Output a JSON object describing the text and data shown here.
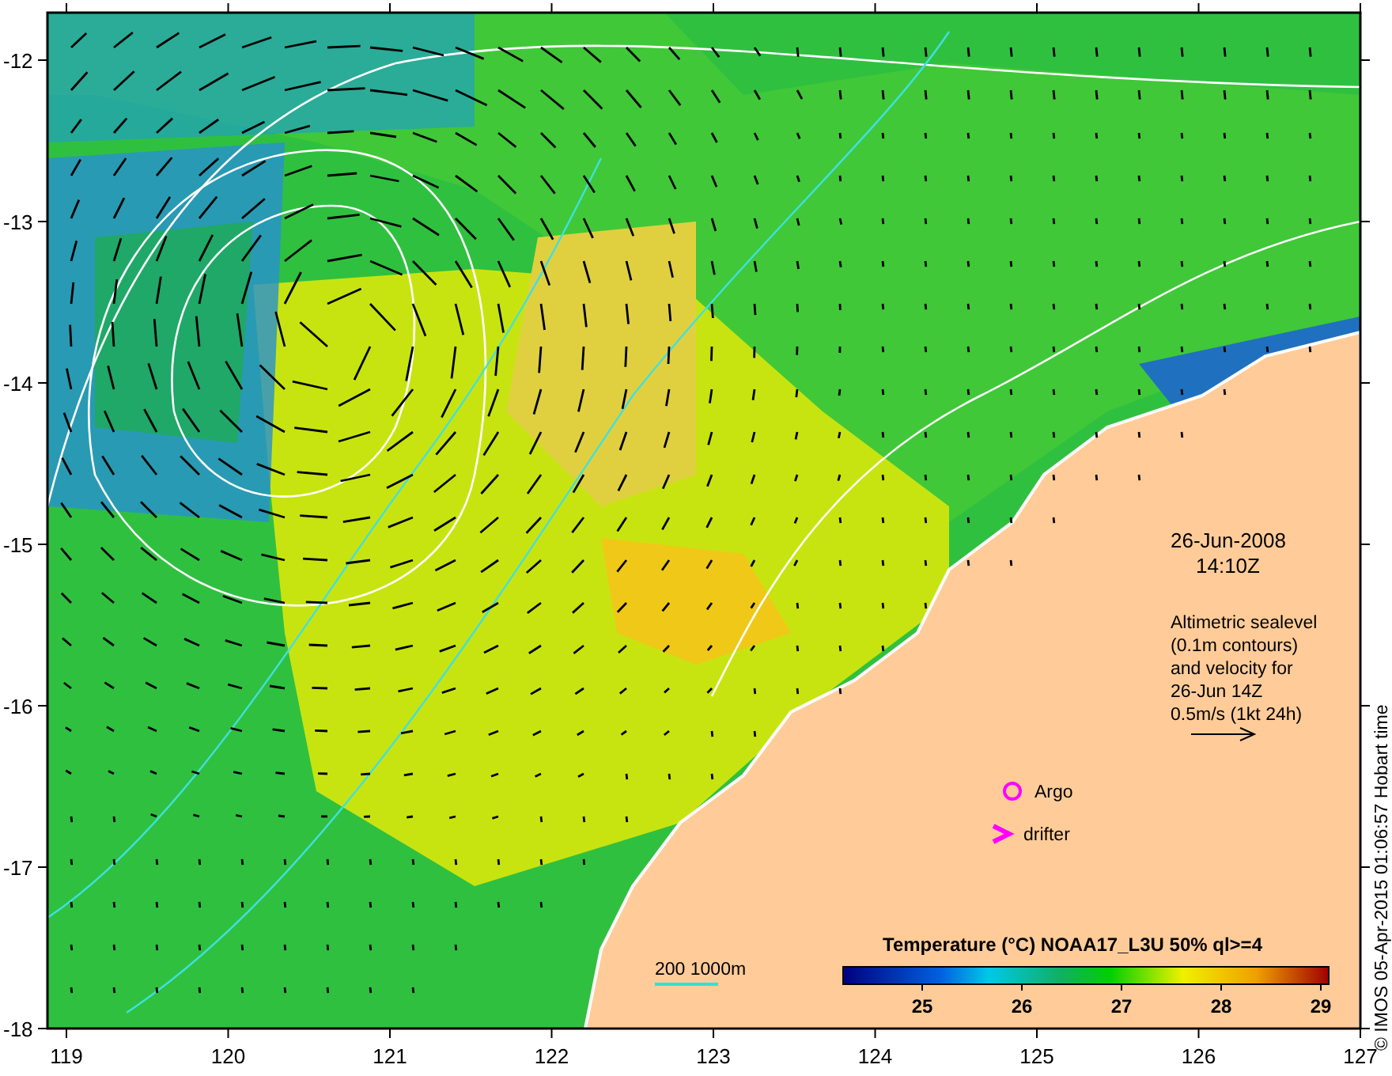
{
  "map": {
    "lat_ticks": [
      "-12",
      "-13",
      "-14",
      "-15",
      "-16",
      "-17",
      "-18"
    ],
    "lon_ticks": [
      "119",
      "120",
      "121",
      "122",
      "123",
      "124",
      "125",
      "126",
      "127"
    ],
    "date": "26-Jun-2008",
    "time": "14:10Z",
    "legend_lines": [
      "Altimetric sealevel",
      "(0.1m contours)",
      "and velocity for",
      "26-Jun 14Z",
      "0.5m/s (1kt 24h)"
    ],
    "markers": [
      {
        "kind": "argo",
        "label": "Argo"
      },
      {
        "kind": "drifter",
        "label": "drifter"
      }
    ],
    "depth_legend": "200  1000m",
    "colorbar": {
      "title": "Temperature (°C) NOAA17_L3U 50% ql>=4",
      "ticks": [
        "25",
        "26",
        "27",
        "28",
        "29"
      ]
    },
    "credit": "© IMOS 05-Apr-2015 01:06:57 Hobart time"
  }
}
